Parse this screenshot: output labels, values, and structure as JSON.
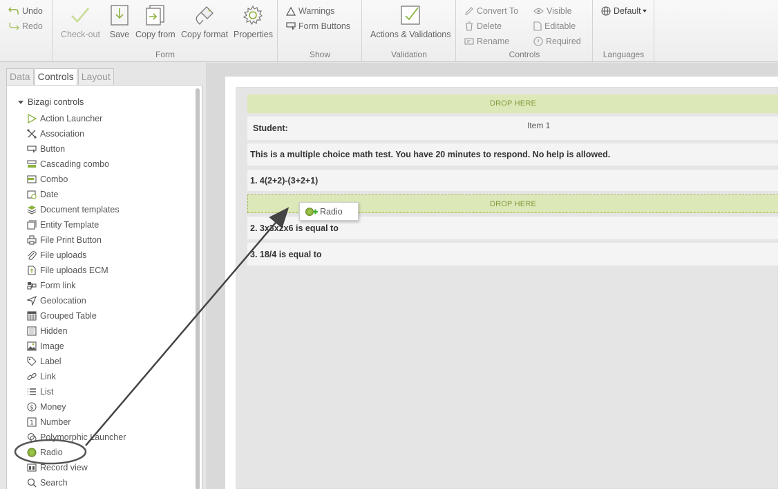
{
  "ribbon": {
    "undo": "Undo",
    "redo": "Redo",
    "form_group": {
      "label": "Form",
      "buttons": [
        "Check-out",
        "Save",
        "Copy from",
        "Copy format",
        "Properties"
      ]
    },
    "show_group": {
      "label": "Show",
      "warnings": "Warnings",
      "form_buttons": "Form Buttons"
    },
    "validation_group": {
      "label": "Validation",
      "actions": "Actions & Validations"
    },
    "controls_group": {
      "label": "Controls",
      "convert_to": "Convert To",
      "delete": "Delete",
      "rename": "Rename",
      "visible": "Visible",
      "editable": "Editable",
      "required": "Required"
    },
    "languages_group": {
      "label": "Languages",
      "default": "Default"
    }
  },
  "left_panel": {
    "tabs": [
      "Data",
      "Controls",
      "Layout"
    ],
    "active_tab": "Controls",
    "tree_root": "Bizagi controls",
    "items": [
      "Action Launcher",
      "Association",
      "Button",
      "Cascading combo",
      "Combo",
      "Date",
      "Document templates",
      "Entity Template",
      "File Print Button",
      "File uploads",
      "File uploads ECM",
      "Form link",
      "Geolocation",
      "Grouped Table",
      "Hidden",
      "Image",
      "Label",
      "Link",
      "List",
      "Money",
      "Number",
      "Polymorphic Launcher",
      "Radio",
      "Record view",
      "Search"
    ],
    "highlighted_item": "Radio"
  },
  "form": {
    "drop_top": "DROP HERE",
    "student_label": "Student:",
    "student_value": "Item 1",
    "intro": "This is a multiple choice math test. You have 20 minutes to respond. No help is allowed.",
    "q1": "1. 4(2+2)-(3+2+1)",
    "drop_active": "DROP HERE",
    "q2": "2. 3x3x2x6 is equal to",
    "q3": "3. 18/4 is equal to"
  },
  "drag_ghost": {
    "label": "Radio"
  },
  "colors": {
    "accent": "#8cb23f",
    "drop_bg": "#dce8b8",
    "drop_text": "#7f9a3a"
  }
}
